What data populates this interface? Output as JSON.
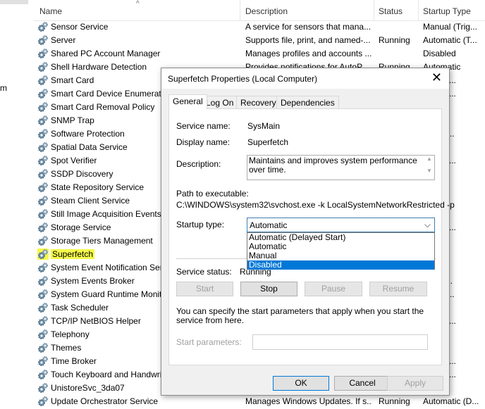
{
  "left_panel": {
    "fragment": "m"
  },
  "columns": {
    "name": "Name",
    "description": "Description",
    "status": "Status",
    "startup": "Startup Type"
  },
  "rows": [
    {
      "name": "Sensor Service",
      "desc": "A service for sensors that mana...",
      "status": "",
      "startup": "Manual (Trig..."
    },
    {
      "name": "Server",
      "desc": "Supports file, print, and named-...",
      "status": "Running",
      "startup": "Automatic (T..."
    },
    {
      "name": "Shared PC Account Manager",
      "desc": "Manages profiles and accounts ...",
      "status": "",
      "startup": "Disabled"
    },
    {
      "name": "Shell Hardware Detection",
      "desc": "Provides notifications for AutoP...",
      "status": "Running",
      "startup": "Automatic"
    },
    {
      "name": "Smart Card",
      "desc": "",
      "status": "",
      "startup": "al (Trig..."
    },
    {
      "name": "Smart Card Device Enumeratio",
      "desc": "",
      "status": "",
      "startup": "al (Trig..."
    },
    {
      "name": "Smart Card Removal Policy",
      "desc": "",
      "status": "",
      "startup": "al"
    },
    {
      "name": "SNMP Trap",
      "desc": "",
      "status": "",
      "startup": "al"
    },
    {
      "name": "Software Protection",
      "desc": "",
      "status": "",
      "startup": "atic (D..."
    },
    {
      "name": "Spatial Data Service",
      "desc": "",
      "status": "",
      "startup": "al"
    },
    {
      "name": "Spot Verifier",
      "desc": "",
      "status": "",
      "startup": "al (Trig..."
    },
    {
      "name": "SSDP Discovery",
      "desc": "",
      "status": "",
      "startup": "al"
    },
    {
      "name": "State Repository Service",
      "desc": "",
      "status": "",
      "startup": "al"
    },
    {
      "name": "Steam Client Service",
      "desc": "",
      "status": "",
      "startup": "al"
    },
    {
      "name": "Still Image Acquisition Events",
      "desc": "",
      "status": "",
      "startup": "al"
    },
    {
      "name": "Storage Service",
      "desc": "",
      "status": "",
      "startup": "al (Trig..."
    },
    {
      "name": "Storage Tiers Management",
      "desc": "",
      "status": "",
      "startup": "al"
    },
    {
      "name": "Superfetch",
      "desc": "",
      "status": "",
      "startup": "atic"
    },
    {
      "name": "System Event Notification Ser",
      "desc": "",
      "status": "",
      "startup": "atic"
    },
    {
      "name": "System Events Broker",
      "desc": "",
      "status": "",
      "startup": "atic (T..."
    },
    {
      "name": "System Guard Runtime Monit",
      "desc": "",
      "status": "",
      "startup": "atic (D..."
    },
    {
      "name": "Task Scheduler",
      "desc": "",
      "status": "",
      "startup": "atic"
    },
    {
      "name": "TCP/IP NetBIOS Helper",
      "desc": "",
      "status": "",
      "startup": "al (Trig..."
    },
    {
      "name": "Telephony",
      "desc": "",
      "status": "",
      "startup": "al"
    },
    {
      "name": "Themes",
      "desc": "",
      "status": "",
      "startup": "atic"
    },
    {
      "name": "Time Broker",
      "desc": "",
      "status": "",
      "startup": "al (Trig..."
    },
    {
      "name": "Touch Keyboard and Handwri",
      "desc": "",
      "status": "",
      "startup": "al (Trig..."
    },
    {
      "name": "UnistoreSvc_3da07",
      "desc": "",
      "status": "",
      "startup": "al"
    },
    {
      "name": "Update Orchestrator Service",
      "desc": "Manages Windows Updates. If s...",
      "status": "Running",
      "startup": "Automatic (D..."
    }
  ],
  "dialog": {
    "title": "Superfetch Properties (Local Computer)",
    "close": "✕",
    "tabs": [
      "General",
      "Log On",
      "Recovery",
      "Dependencies"
    ],
    "service_name_label": "Service name:",
    "service_name": "SysMain",
    "display_name_label": "Display name:",
    "display_name": "Superfetch",
    "description_label": "Description:",
    "description": "Maintains and improves system performance over time.",
    "path_label": "Path to executable:",
    "path": "C:\\WINDOWS\\system32\\svchost.exe -k LocalSystemNetworkRestricted -p",
    "startup_label": "Startup type:",
    "startup_value": "Automatic",
    "startup_options": [
      "Automatic (Delayed Start)",
      "Automatic",
      "Manual",
      "Disabled"
    ],
    "status_label": "Service status:",
    "status_value": "Running",
    "buttons": {
      "start": "Start",
      "stop": "Stop",
      "pause": "Pause",
      "resume": "Resume"
    },
    "hint": "You can specify the start parameters that apply when you start the service from here.",
    "param_label": "Start parameters:",
    "ok": "OK",
    "cancel": "Cancel",
    "apply": "Apply"
  },
  "colors": {
    "highlight": "#f4f94a",
    "selection": "#0078d7"
  },
  "icons": {
    "service": "gear-icon",
    "close": "close-icon",
    "dropdown": "chevron-down-icon"
  }
}
